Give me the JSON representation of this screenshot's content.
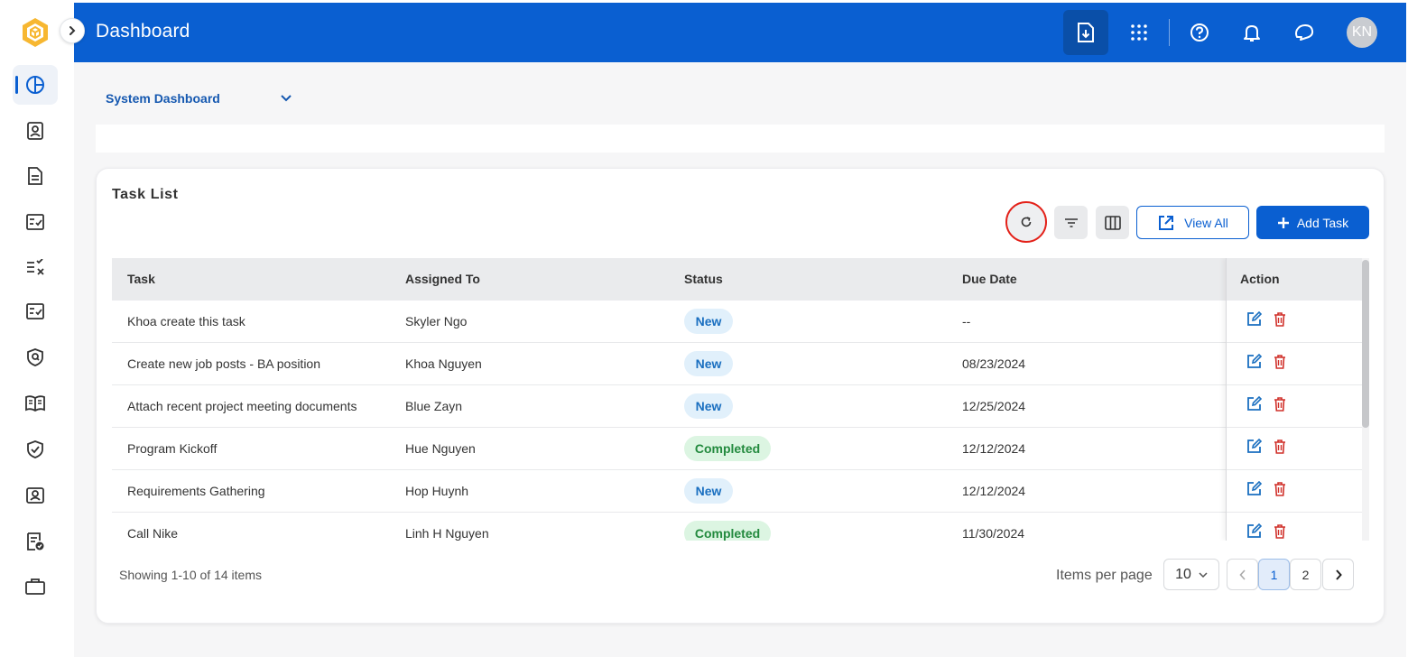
{
  "header": {
    "title": "Dashboard",
    "avatar_initials": "KN"
  },
  "sidebar": {
    "items": [
      {
        "icon": "dashboard-icon",
        "active": true
      },
      {
        "icon": "contact-book-icon"
      },
      {
        "icon": "document-icon"
      },
      {
        "icon": "task-checklist-icon"
      },
      {
        "icon": "list-check-x-icon"
      },
      {
        "icon": "checklist-icon"
      },
      {
        "icon": "shield-search-icon"
      },
      {
        "icon": "open-book-icon"
      },
      {
        "icon": "shield-check-icon"
      },
      {
        "icon": "profile-card-icon"
      },
      {
        "icon": "document-approved-icon"
      },
      {
        "icon": "briefcase-icon"
      }
    ]
  },
  "dashboard_select": {
    "value": "System Dashboard"
  },
  "task_list": {
    "title": "Task List",
    "view_all_label": "View All",
    "add_task_label": "Add Task",
    "columns": [
      "Task",
      "Assigned To",
      "Status",
      "Due Date",
      "Action"
    ],
    "rows": [
      {
        "task": "Khoa create this task",
        "assigned_to": "Skyler Ngo",
        "status": "New",
        "due_date": "--"
      },
      {
        "task": "Create new job posts - BA position",
        "assigned_to": "Khoa Nguyen",
        "status": "New",
        "due_date": "08/23/2024"
      },
      {
        "task": "Attach recent project meeting documents",
        "assigned_to": "Blue Zayn",
        "status": "New",
        "due_date": "12/25/2024"
      },
      {
        "task": "Program Kickoff",
        "assigned_to": "Hue Nguyen",
        "status": "Completed",
        "due_date": "12/12/2024"
      },
      {
        "task": "Requirements Gathering",
        "assigned_to": "Hop Huynh",
        "status": "New",
        "due_date": "12/12/2024"
      },
      {
        "task": "Call Nike",
        "assigned_to": "Linh H Nguyen",
        "status": "Completed",
        "due_date": "11/30/2024"
      }
    ]
  },
  "pagination": {
    "showing": "Showing 1-10 of 14 items",
    "items_per_page_label": "Items per page",
    "items_per_page_value": "10",
    "pages": [
      "1",
      "2"
    ],
    "current_page": "1"
  },
  "colors": {
    "brand": "#0a5fd1",
    "new_badge_bg": "#e1f0fb",
    "completed_badge_bg": "#dcf5e2",
    "delete": "#d0302a",
    "highlight": "#e32119"
  }
}
